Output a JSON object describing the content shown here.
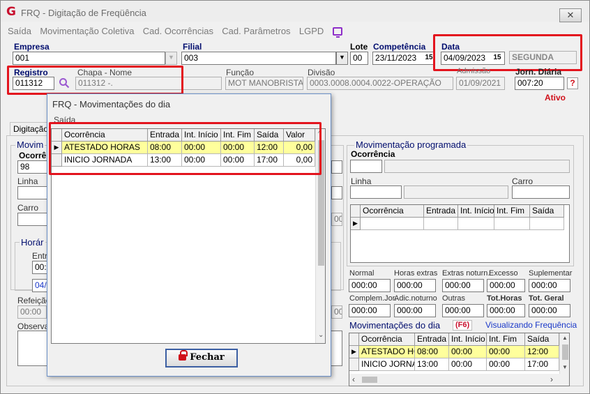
{
  "window": {
    "title": "FRQ - Digitação de Freqüência",
    "close_symbol": "✕"
  },
  "menu": [
    {
      "label": "Saída"
    },
    {
      "label": "Movimentação Coletiva"
    },
    {
      "label": "Cad. Ocorrências"
    },
    {
      "label": "Cad. Parâmetros"
    },
    {
      "label": "LGPD"
    }
  ],
  "header": {
    "empresa_label": "Empresa",
    "empresa_value": "001",
    "filial_label": "Filial",
    "filial_value": "003",
    "lote_label": "Lote",
    "lote_value": "00",
    "competencia_label": "Competência",
    "competencia_value": "23/11/2023",
    "data_label": "Data",
    "data_value": "04/09/2023",
    "dia_semana": "SEGUNDA",
    "registro_label": "Registro",
    "registro_value": "011312",
    "chapa_nome_label": "Chapa  -  Nome",
    "chapa_nome_value": "011312 -.",
    "funcao_label": "Função",
    "funcao_value": "MOT MANOBRISTA",
    "divisao_label": "Divisão",
    "divisao_value": "0003.0008.0004.0022-OPERAÇÃO",
    "admissao_label": "Admissão",
    "admissao_value": "01/09/2021",
    "jorn_label": "Jorn. Diária",
    "jorn_value": "007:20",
    "help_label": "?",
    "status": "Ativo"
  },
  "left_panel": {
    "tab_label": "Digitação",
    "group_title": "Movim",
    "ocorrencia_label": "Ocorrê",
    "ocorrencia_value": "98",
    "linha_label": "Linha",
    "carro_label": "Carro",
    "horario_label": "Horár",
    "entrada_label": "Entr",
    "entrada_value": "00:0",
    "date_value": "04/",
    "refeicao_label": "Refeição",
    "refeicao_value": "00:00",
    "observ_label": "Observa"
  },
  "modal": {
    "title": "FRQ - Movimentações do dia",
    "menu_saida": "Saída",
    "columns": [
      "Ocorrência",
      "Entrada",
      "Int. Início",
      "Int. Fim",
      "Saída",
      "Valor"
    ],
    "rows": [
      {
        "ocorrencia": "ATESTADO HORAS",
        "entrada": "08:00",
        "int_inicio": "00:00",
        "int_fim": "00:00",
        "saida": "12:00",
        "valor": "0,00"
      },
      {
        "ocorrencia": "INICIO JORNADA",
        "entrada": "13:00",
        "int_inicio": "00:00",
        "int_fim": "00:00",
        "saida": "17:00",
        "valor": "0,00"
      }
    ],
    "fechar_label": "Fechar"
  },
  "right_panel": {
    "group_title": "Movimentação programada",
    "ocorrencia_label": "Ocorrência",
    "linha_label": "Linha",
    "carro_label": "Carro",
    "grid_columns": [
      "Ocorrência",
      "Entrada",
      "Int. Início",
      "Int. Fim",
      "Saída"
    ],
    "totals": {
      "labels_row1": [
        "Normal",
        "Horas extras",
        "Extras noturn.",
        "Excesso",
        "Suplementar"
      ],
      "values_row1": [
        "000:00",
        "000:00",
        "000:00",
        "000:00",
        "000:00"
      ],
      "labels_row2": [
        "Complem.Jor.",
        "Adic.noturno",
        "Outras",
        "Tot.Horas",
        "Tot. Geral"
      ],
      "values_row2": [
        "000:00",
        "000:00",
        "000:00",
        "000:00",
        "000:00"
      ]
    },
    "mov_dia_title": "Movimentações do dia",
    "f6_label": "(F6)",
    "visualizando": "Visualizando Frequência",
    "mov_columns": [
      "Ocorrência",
      "Entrada",
      "Int. Início",
      "Int. Fim",
      "Saída"
    ],
    "mov_rows": [
      {
        "ocorrencia": "ATESTADO HO",
        "entrada": "08:00",
        "int_inicio": "00:00",
        "int_fim": "00:00",
        "saida": "12:00"
      },
      {
        "ocorrencia": "INICIO JORNA",
        "entrada": "13:00",
        "int_inicio": "00:00",
        "int_fim": "00:00",
        "saida": "17:00"
      }
    ]
  },
  "colors": {
    "label_blue": "#000d6e",
    "highlight_red": "#e3141e",
    "row_highlight": "#ffff9c",
    "link_blue": "#1a38c8"
  }
}
